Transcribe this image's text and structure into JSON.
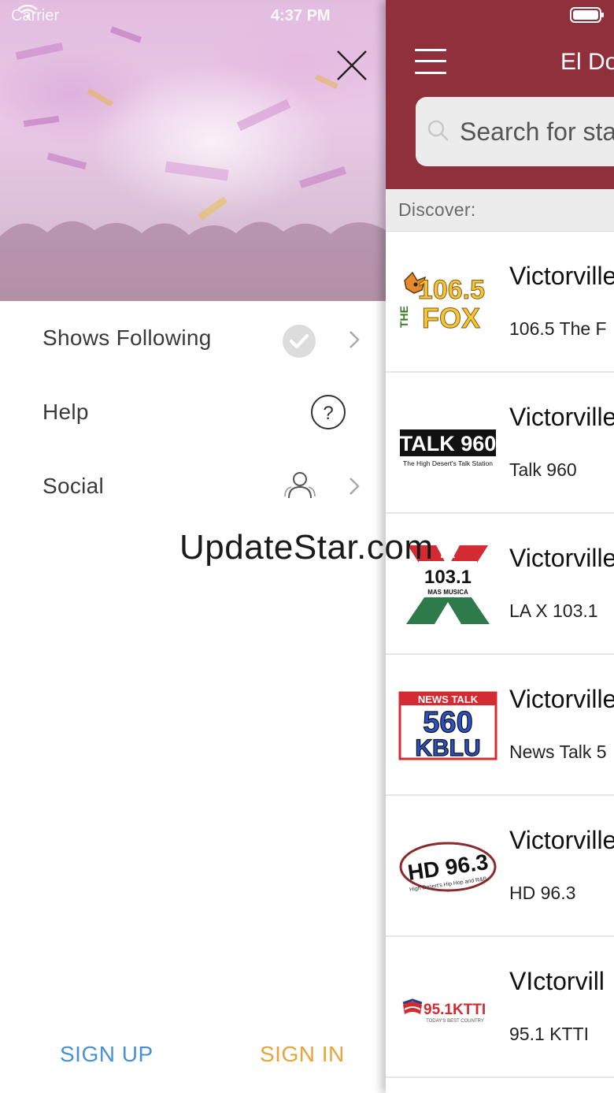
{
  "status_bar": {
    "carrier": "Carrier",
    "time": "4:37 PM"
  },
  "drawer": {
    "menu": [
      {
        "label": "Shows Following",
        "icon": "check-circle-icon",
        "has_chevron": true
      },
      {
        "label": "Help",
        "icon": "question-circle-icon",
        "has_chevron": false
      },
      {
        "label": "Social",
        "icon": "people-icon",
        "has_chevron": true
      }
    ],
    "sign_up": "SIGN UP",
    "sign_in": "SIGN IN"
  },
  "watermark": "UpdateStar.com",
  "main": {
    "title": "El Do",
    "search_placeholder": "Search for sta",
    "discover_label": "Discover:",
    "stations": [
      {
        "title": "Victorville",
        "subtitle": "106.5 The F",
        "logo": {
          "type": "fox",
          "text_top": "106.5",
          "text_bottom": "FOX",
          "text_side": "THE"
        }
      },
      {
        "title": "Victorville",
        "subtitle": "Talk 960",
        "logo": {
          "type": "talk",
          "text_top": "TALK 960",
          "text_bottom": "The High Desert's Talk Station"
        }
      },
      {
        "title": "Victorville",
        "subtitle": "LA X 103.1",
        "logo": {
          "type": "lax",
          "text_top": "La",
          "text_mid": "103.1",
          "text_bottom": "MAS MUSICA"
        }
      },
      {
        "title": "Victorville",
        "subtitle": "News Talk 5",
        "logo": {
          "type": "kblu",
          "text_top": "NEWS TALK",
          "text_mid": "560",
          "text_bottom": "KBLU"
        }
      },
      {
        "title": "Victorville",
        "subtitle": "HD 96.3",
        "logo": {
          "type": "hd",
          "text_top": "HD 96.3",
          "text_bottom": "High Desert's Hip Hop and R&B"
        }
      },
      {
        "title": "VIctorvill",
        "subtitle": "95.1 KTTI",
        "logo": {
          "type": "ktti",
          "text_top": "95.1KTTI",
          "text_bottom": "TODAY'S BEST COUNTRY"
        }
      }
    ]
  },
  "colors": {
    "header": "#90303d",
    "sign_up": "#4a90d9",
    "sign_in": "#e8a43a"
  }
}
